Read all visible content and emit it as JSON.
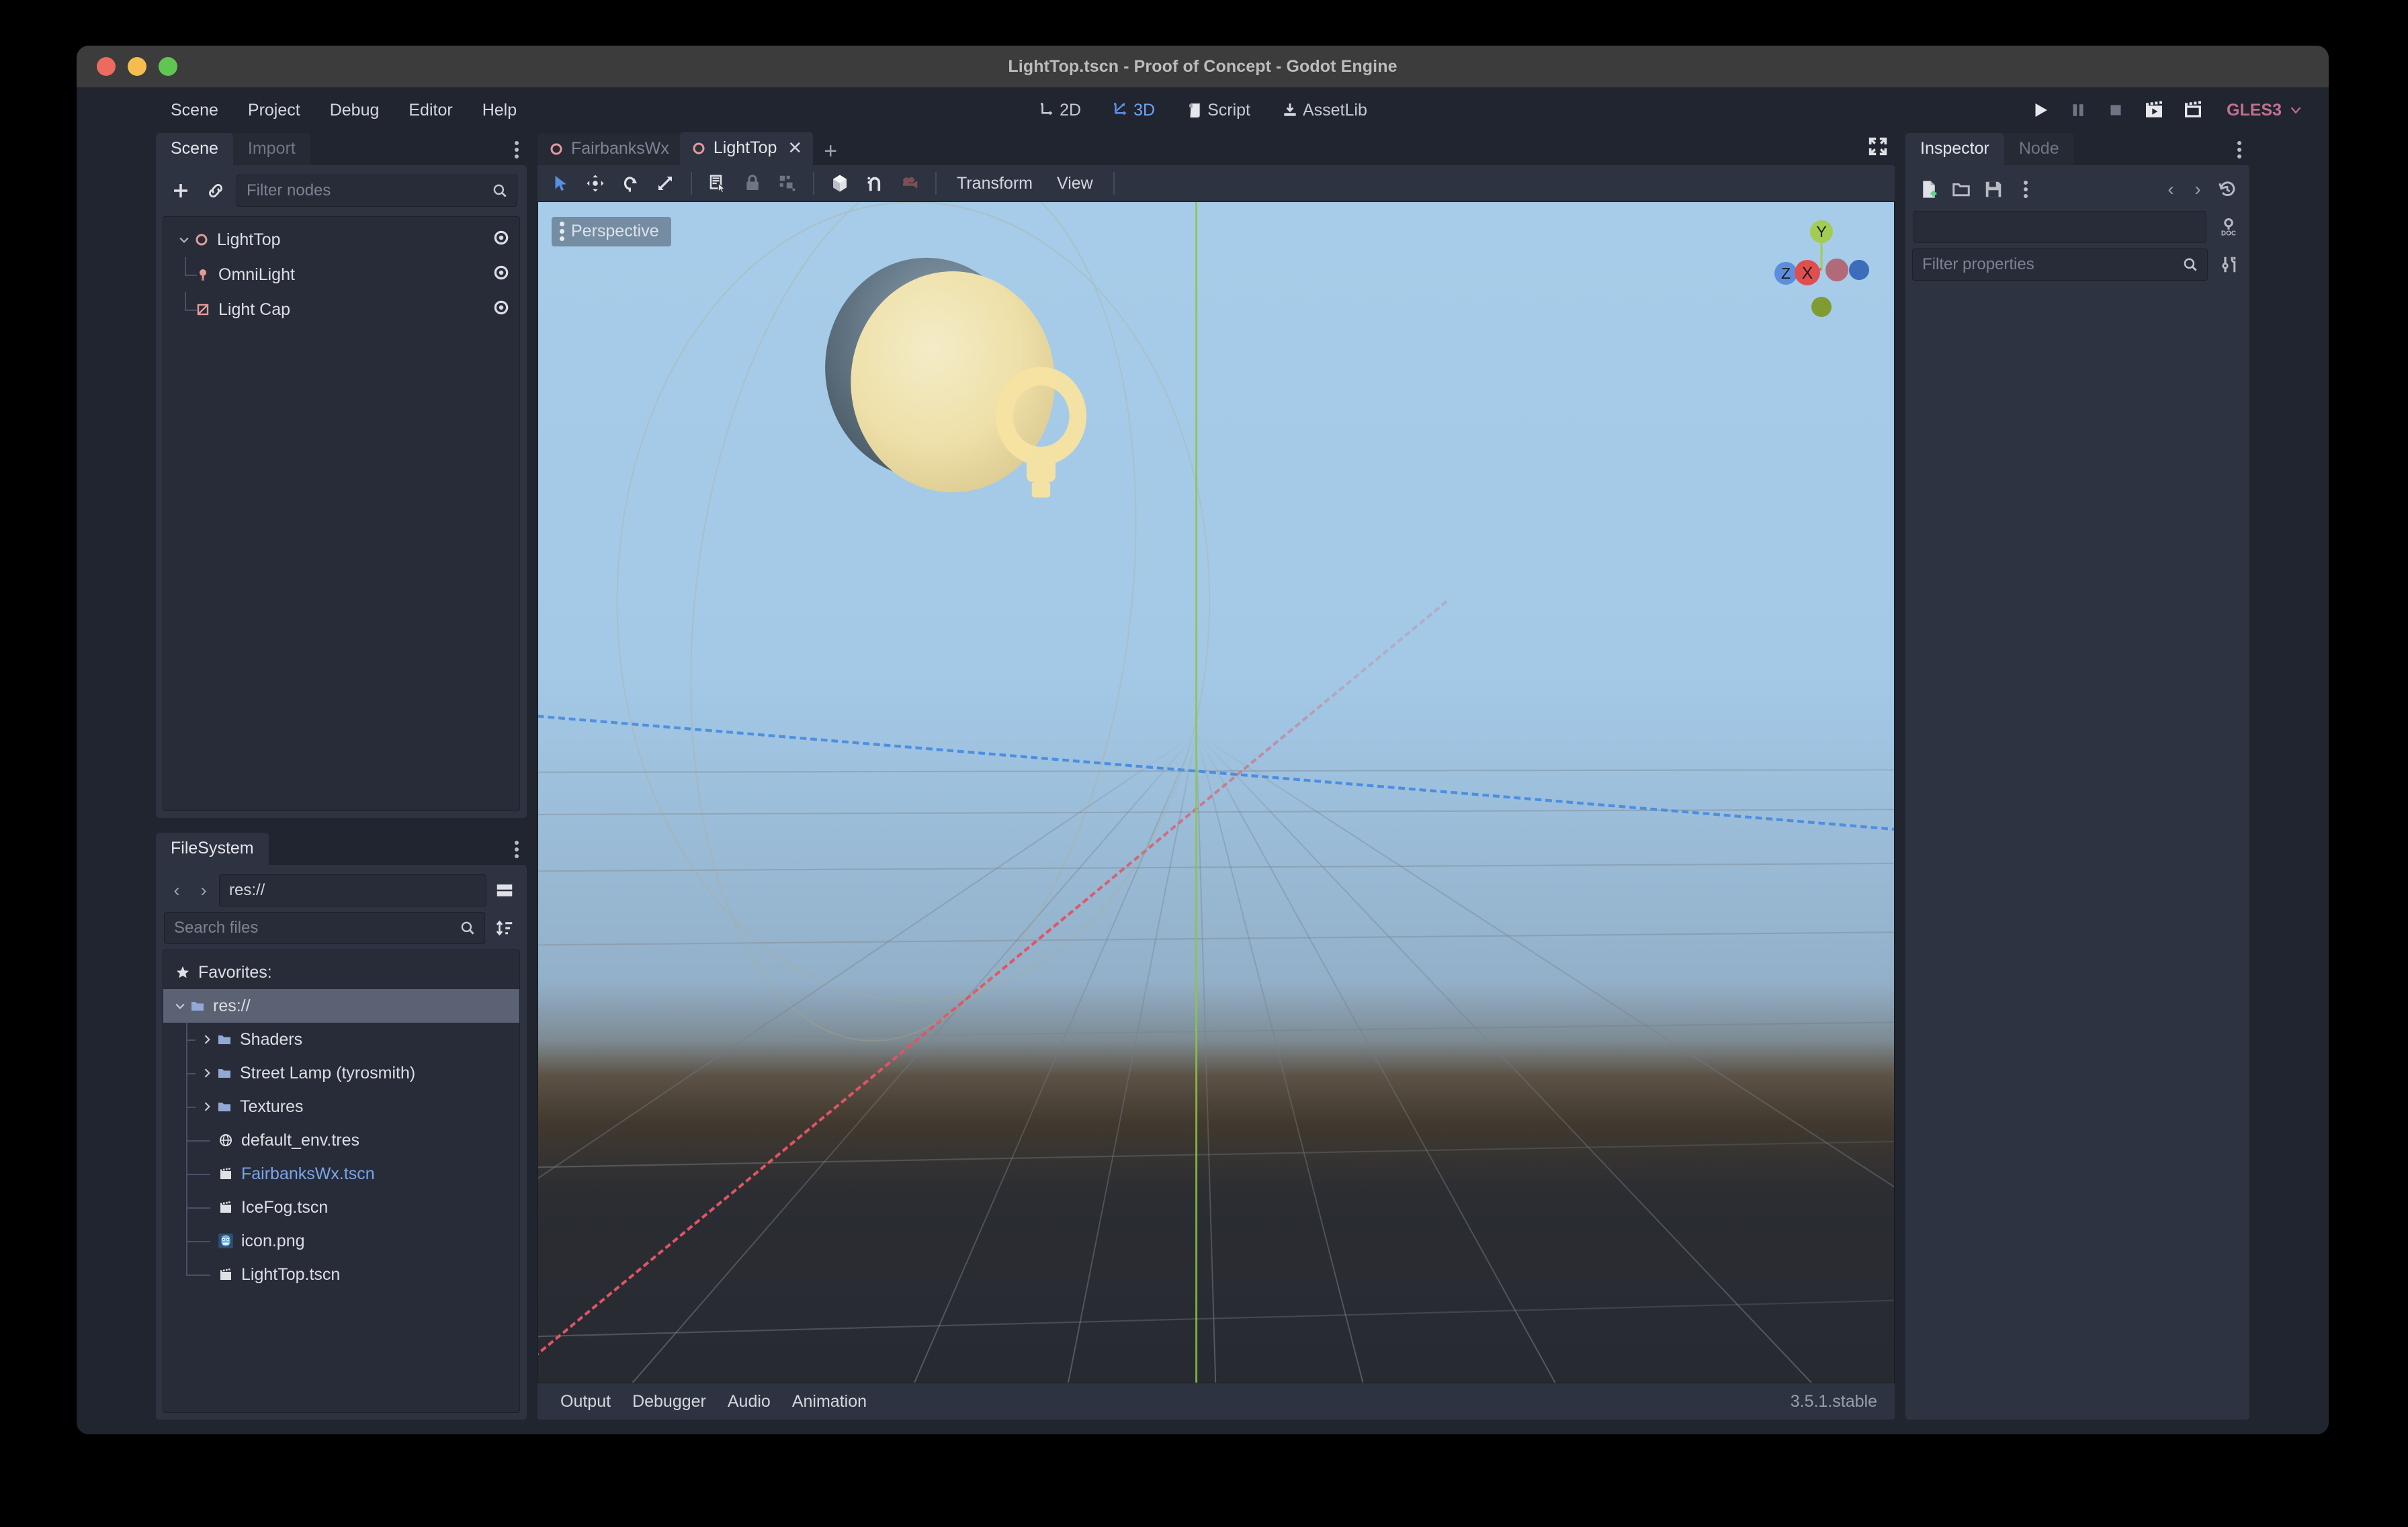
{
  "window": {
    "title": "LightTop.tscn - Proof of Concept - Godot Engine",
    "traffic_lights": [
      "close",
      "minimize",
      "maximize"
    ]
  },
  "menubar": {
    "items": [
      {
        "label": "Scene"
      },
      {
        "label": "Project"
      },
      {
        "label": "Debug"
      },
      {
        "label": "Editor"
      },
      {
        "label": "Help"
      }
    ],
    "main_tabs": [
      {
        "label": "2D",
        "icon": "2d-icon",
        "active": false
      },
      {
        "label": "3D",
        "icon": "3d-icon",
        "active": true
      },
      {
        "label": "Script",
        "icon": "script-icon",
        "active": false
      },
      {
        "label": "AssetLib",
        "icon": "assetlib-icon",
        "active": false
      }
    ],
    "playback": [
      {
        "name": "play-button",
        "icon": "play-icon"
      },
      {
        "name": "pause-button",
        "icon": "pause-icon"
      },
      {
        "name": "stop-button",
        "icon": "stop-icon"
      },
      {
        "name": "play-scene-button",
        "icon": "play-scene-icon"
      },
      {
        "name": "play-custom-scene-button",
        "icon": "play-custom-scene-icon"
      }
    ],
    "renderer": {
      "label": "GLES3"
    }
  },
  "scene_dock": {
    "tabs": [
      {
        "label": "Scene",
        "active": true
      },
      {
        "label": "Import",
        "active": false
      }
    ],
    "toolbar": {
      "add_node_label": "+",
      "instance_label": "link-icon"
    },
    "filter": {
      "placeholder": "Filter nodes",
      "value": ""
    },
    "tree": [
      {
        "label": "LightTop",
        "icon": "spatial-node-icon",
        "depth": 0,
        "expanded": true,
        "visible_toggle": true
      },
      {
        "label": "OmniLight",
        "icon": "omnilight-node-icon",
        "depth": 1,
        "expanded": false,
        "visible_toggle": true
      },
      {
        "label": "Light Cap",
        "icon": "meshinstance-node-icon",
        "depth": 1,
        "expanded": false,
        "visible_toggle": true
      }
    ]
  },
  "filesystem_dock": {
    "tabs": [
      {
        "label": "FileSystem",
        "active": true
      }
    ],
    "path": {
      "value": "res://"
    },
    "search": {
      "placeholder": "Search files",
      "value": ""
    },
    "tree": [
      {
        "label": "Favorites:",
        "icon": "star-icon",
        "depth": 0,
        "kind": "header",
        "selected": false
      },
      {
        "label": "res://",
        "icon": "folder-icon",
        "depth": 0,
        "kind": "folder",
        "expanded": true,
        "selected": true
      },
      {
        "label": "Shaders",
        "icon": "folder-icon",
        "depth": 1,
        "kind": "folder",
        "expanded": false,
        "selected": false
      },
      {
        "label": "Street Lamp (tyrosmith)",
        "icon": "folder-icon",
        "depth": 1,
        "kind": "folder",
        "expanded": false,
        "selected": false
      },
      {
        "label": "Textures",
        "icon": "folder-icon",
        "depth": 1,
        "kind": "folder",
        "expanded": false,
        "selected": false
      },
      {
        "label": "default_env.tres",
        "icon": "environment-resource-icon",
        "depth": 1,
        "kind": "file",
        "selected": false
      },
      {
        "label": "FairbanksWx.tscn",
        "icon": "packed-scene-icon",
        "depth": 1,
        "kind": "file",
        "selected": false,
        "highlight": true
      },
      {
        "label": "IceFog.tscn",
        "icon": "packed-scene-icon",
        "depth": 1,
        "kind": "file",
        "selected": false
      },
      {
        "label": "icon.png",
        "icon": "godot-png-icon",
        "depth": 1,
        "kind": "file",
        "selected": false
      },
      {
        "label": "LightTop.tscn",
        "icon": "packed-scene-icon",
        "depth": 1,
        "kind": "file",
        "selected": false
      }
    ]
  },
  "viewport": {
    "scene_tabs": [
      {
        "label": "FairbanksWx",
        "icon": "spatial-node-icon",
        "active": false,
        "closable": false
      },
      {
        "label": "LightTop",
        "icon": "spatial-node-icon",
        "active": true,
        "closable": true
      }
    ],
    "new_tab_label": "+",
    "close_label": "✕",
    "toolbar": [
      {
        "name": "select-mode-button",
        "icon": "cursor-arrow-icon",
        "active": true
      },
      {
        "name": "move-mode-button",
        "icon": "move-icon",
        "active": false
      },
      {
        "name": "rotate-mode-button",
        "icon": "rotate-icon",
        "active": false
      },
      {
        "name": "scale-mode-button",
        "icon": "scale-icon",
        "active": false
      },
      {
        "name": "list-select-button",
        "icon": "list-select-icon",
        "active": false
      },
      {
        "name": "lock-selected-button",
        "icon": "lock-icon",
        "active": false
      },
      {
        "name": "group-selected-button",
        "icon": "group-icon",
        "active": false
      },
      {
        "name": "local-space-button",
        "icon": "cube-icon",
        "active": false
      },
      {
        "name": "snap-mode-button",
        "icon": "magnet-snap-icon",
        "active": false
      },
      {
        "name": "camera-preview-button",
        "icon": "camera-icon",
        "active": false
      }
    ],
    "menus": [
      {
        "label": "Transform"
      },
      {
        "label": "View"
      }
    ],
    "expand_button": {
      "icon": "expand-icon"
    },
    "overlay": {
      "perspective_label": "Perspective"
    },
    "gizmo": {
      "axes": [
        {
          "label": "Y",
          "color": "#a2cd52"
        },
        {
          "label": "X",
          "color": "#e04f4f"
        },
        {
          "label": "Z",
          "color": "#5b8fde"
        }
      ],
      "neg_x_color": "#b16a78",
      "neg_y_color": "#7f9b32",
      "neg_z_color": "#3b6dbb"
    },
    "scene_objects": [
      {
        "name": "light-cap-sphere",
        "type": "MeshInstance",
        "color": "#eee0a8"
      },
      {
        "name": "omnilight-gizmo",
        "type": "OmniLight",
        "color": "#f6e09a"
      }
    ],
    "grid": {
      "x_axis_color": "#e05464",
      "y_axis_color": "#8ec449",
      "z_axis_color": "#4a8ee0",
      "line_color": "#5b6068"
    }
  },
  "bottom_panel": {
    "items": [
      {
        "label": "Output"
      },
      {
        "label": "Debugger"
      },
      {
        "label": "Audio"
      },
      {
        "label": "Animation"
      }
    ],
    "version": "3.5.1.stable"
  },
  "inspector_dock": {
    "tabs": [
      {
        "label": "Inspector",
        "active": true
      },
      {
        "label": "Node",
        "active": false
      }
    ],
    "toolbar": [
      {
        "name": "new-resource-button",
        "icon": "new-file-icon"
      },
      {
        "name": "load-resource-button",
        "icon": "open-folder-icon"
      },
      {
        "name": "save-resource-button",
        "icon": "save-disk-icon"
      },
      {
        "name": "extra-options-button",
        "icon": "vertical-dots-icon"
      },
      {
        "name": "history-prev-button",
        "icon": "chevron-left-icon"
      },
      {
        "name": "history-next-button",
        "icon": "chevron-right-icon"
      },
      {
        "name": "history-button",
        "icon": "history-clock-icon"
      }
    ],
    "side_buttons": [
      {
        "name": "open-docs-button",
        "icon": "search-doc-icon"
      },
      {
        "name": "object-tools-button",
        "icon": "tools-icon"
      }
    ],
    "filter": {
      "placeholder": "Filter properties",
      "value": ""
    }
  },
  "colors": {
    "accent": "#6da4f0",
    "renderer_text": "#c2708f",
    "panel_bg": "#2e3342",
    "editor_bg": "#21252f",
    "field_bg": "#272c38",
    "selected_row": "#5a6274",
    "node_icon_red": "#e59a9a"
  }
}
